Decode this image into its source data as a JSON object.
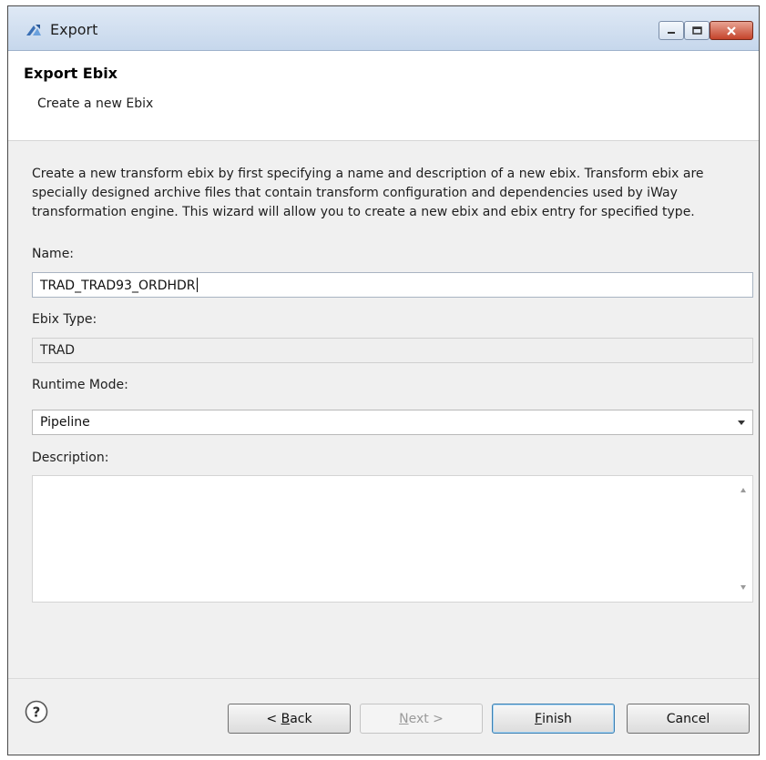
{
  "window": {
    "title": "Export",
    "min_icon": "minimize-icon",
    "max_icon": "maximize-icon",
    "close_icon": "close-icon"
  },
  "header": {
    "title": "Export Ebix",
    "subtitle": "Create a new Ebix"
  },
  "content": {
    "intro": "Create a new transform ebix by first specifying a name and description of a new ebix. Transform ebix are specially designed archive files that contain transform configuration and dependencies used by iWay transformation engine. This wizard will allow you to create a new ebix and ebix entry for specified type.",
    "name_label": "Name:",
    "name_value": "TRAD_TRAD93_ORDHDR",
    "ebix_type_label": "Ebix Type:",
    "ebix_type_value": "TRAD",
    "runtime_mode_label": "Runtime Mode:",
    "runtime_mode_value": "Pipeline",
    "description_label": "Description:",
    "description_value": ""
  },
  "footer": {
    "help_icon": "help-icon",
    "back_mnemonic": "B",
    "back_rest": "ack",
    "back_prefix": "< ",
    "next_mnemonic": "N",
    "next_rest": "ext >",
    "finish_mnemonic": "F",
    "finish_rest": "inish",
    "cancel_label": "Cancel"
  },
  "colors": {
    "dialog_bg": "#f0f0f0",
    "close_button": "#c4432b",
    "default_button_border": "#3c7fb1"
  }
}
